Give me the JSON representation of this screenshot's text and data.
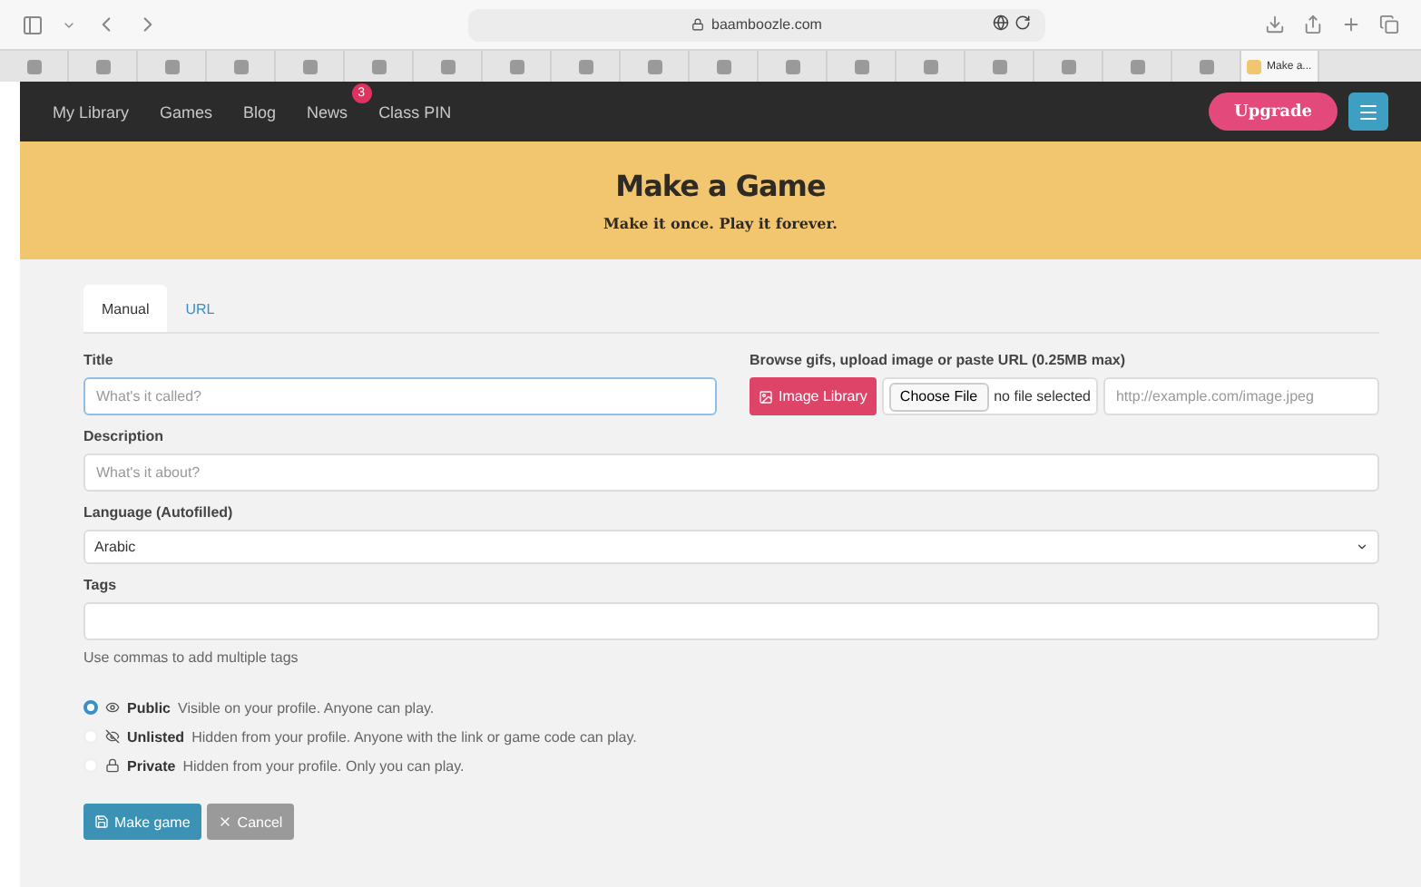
{
  "browser": {
    "url": "baamboozle.com",
    "tabs": [
      {
        "selected": false
      },
      {
        "selected": false
      },
      {
        "selected": false
      },
      {
        "selected": false
      },
      {
        "selected": false
      },
      {
        "selected": false
      },
      {
        "selected": false
      },
      {
        "selected": false
      },
      {
        "selected": false
      },
      {
        "selected": false
      },
      {
        "selected": false
      },
      {
        "selected": false
      },
      {
        "selected": false
      },
      {
        "selected": false
      },
      {
        "selected": false
      },
      {
        "selected": false
      },
      {
        "selected": false
      },
      {
        "selected": false
      },
      {
        "selected": true,
        "title": "Make a..."
      }
    ]
  },
  "nav": {
    "items": [
      {
        "label": "My Library"
      },
      {
        "label": "Games"
      },
      {
        "label": "Blog"
      },
      {
        "label": "News",
        "badge": "3"
      },
      {
        "label": "Class PIN"
      }
    ],
    "upgrade": "Upgrade"
  },
  "banner": {
    "title": "Make a Game",
    "subtitle": "Make it once. Play it forever."
  },
  "form_tabs": [
    {
      "label": "Manual",
      "selected": true
    },
    {
      "label": "URL",
      "selected": false
    }
  ],
  "title_field": {
    "label": "Title",
    "placeholder": "What's it called?"
  },
  "image": {
    "label": "Browse gifs, upload image or paste URL (0.25MB max)",
    "library_button": "Image Library",
    "choose_file": "Choose File",
    "file_status": "no file selected",
    "url_placeholder": "http://example.com/image.jpeg"
  },
  "description": {
    "label": "Description",
    "placeholder": "What's it about?"
  },
  "language": {
    "label": "Language (Autofilled)",
    "value": "Arabic"
  },
  "tags": {
    "label": "Tags",
    "help": "Use commas to add multiple tags"
  },
  "visibility": [
    {
      "kind": "eye",
      "label": "Public",
      "description": "Visible on your profile. Anyone can play.",
      "selected": true
    },
    {
      "kind": "eye-off",
      "label": "Unlisted",
      "description": "Hidden from your profile. Anyone with the link or game code can play.",
      "selected": false
    },
    {
      "kind": "lock",
      "label": "Private",
      "description": "Hidden from your profile. Only you can play.",
      "selected": false
    }
  ],
  "buttons": {
    "submit": "Make game",
    "cancel": "Cancel"
  }
}
